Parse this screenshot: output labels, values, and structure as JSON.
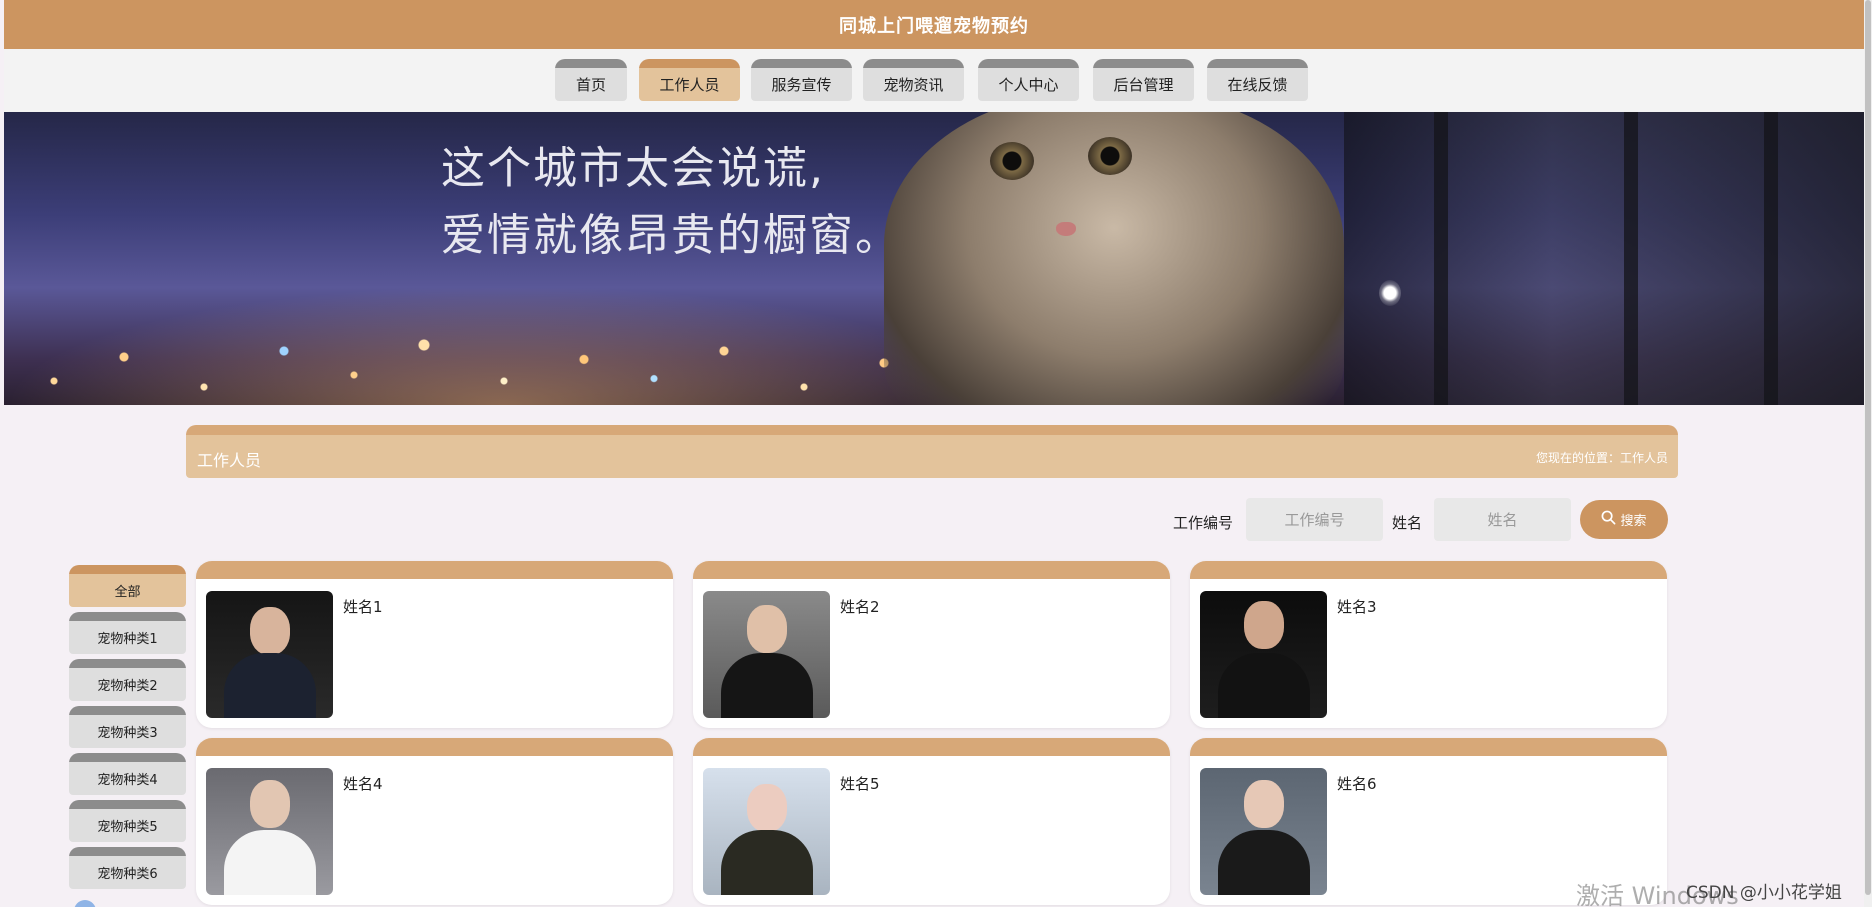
{
  "header": {
    "title": "同城上门喂遛宠物预约"
  },
  "nav": {
    "items": [
      {
        "label": "首页",
        "active": false
      },
      {
        "label": "工作人员",
        "active": true
      },
      {
        "label": "服务宣传",
        "active": false
      },
      {
        "label": "宠物资讯",
        "active": false
      },
      {
        "label": "个人中心",
        "active": false
      },
      {
        "label": "后台管理",
        "active": false
      },
      {
        "label": "在线反馈",
        "active": false
      }
    ]
  },
  "banner": {
    "line1": "这个城市太会说谎,",
    "line2": "爱情就像昂贵的橱窗。"
  },
  "section": {
    "title": "工作人员",
    "breadcrumb": "您现在的位置：工作人员"
  },
  "search": {
    "staff_no_label": "工作编号",
    "staff_no_placeholder": "工作编号",
    "name_label": "姓名",
    "name_placeholder": "姓名",
    "button_label": "搜索"
  },
  "categories": [
    {
      "label": "全部",
      "active": true
    },
    {
      "label": "宠物种类1",
      "active": false
    },
    {
      "label": "宠物种类2",
      "active": false
    },
    {
      "label": "宠物种类3",
      "active": false
    },
    {
      "label": "宠物种类4",
      "active": false
    },
    {
      "label": "宠物种类5",
      "active": false
    },
    {
      "label": "宠物种类6",
      "active": false
    }
  ],
  "staff": [
    {
      "name": "姓名1"
    },
    {
      "name": "姓名2"
    },
    {
      "name": "姓名3"
    },
    {
      "name": "姓名4"
    },
    {
      "name": "姓名5"
    },
    {
      "name": "姓名6"
    }
  ],
  "overlay": {
    "os_watermark": "激活 Windows",
    "credit": "CSDN @小小花学姐"
  },
  "colors": {
    "brand": "#cc9560",
    "accent_light": "#e3c39b",
    "card_top": "#d7a878"
  }
}
